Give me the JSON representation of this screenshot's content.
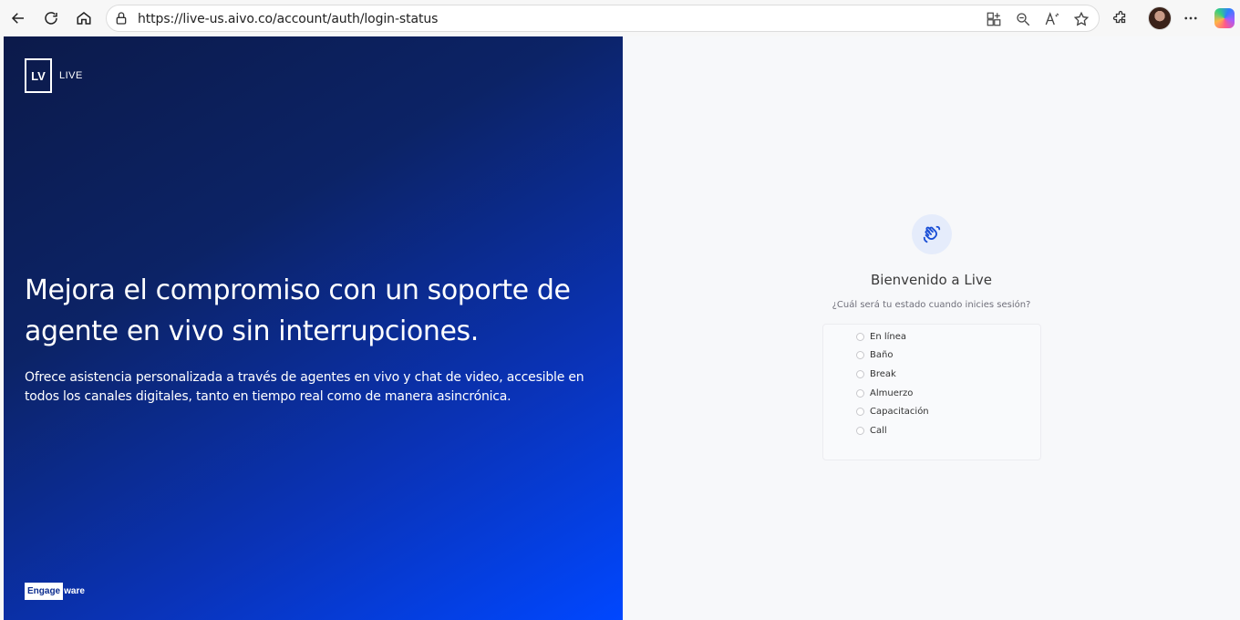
{
  "browser": {
    "url": "https://live-us.aivo.co/account/auth/login-status"
  },
  "hero": {
    "logo_mark": "LV",
    "logo_text": "LIVE",
    "headline": "Mejora el compromiso con un soporte de agente en vivo sin interrupciones.",
    "description": "Ofrece asistencia personalizada a través de agentes en vivo y chat de video, accesible en todos los canales digitales, tanto en tiempo real como de manera asincrónica.",
    "brand_part1": "Engage",
    "brand_part2": "ware"
  },
  "login": {
    "welcome": "Bienvenido a Live",
    "question": "¿Cuál será tu estado cuando inicies sesión?",
    "options": [
      {
        "label": "En línea"
      },
      {
        "label": "Baño"
      },
      {
        "label": "Break"
      },
      {
        "label": "Almuerzo"
      },
      {
        "label": "Capacitación"
      },
      {
        "label": "Call"
      }
    ]
  },
  "colors": {
    "hero_start": "#0c1a4a",
    "hero_end": "#0047ff",
    "accent": "#1a4fd6"
  }
}
